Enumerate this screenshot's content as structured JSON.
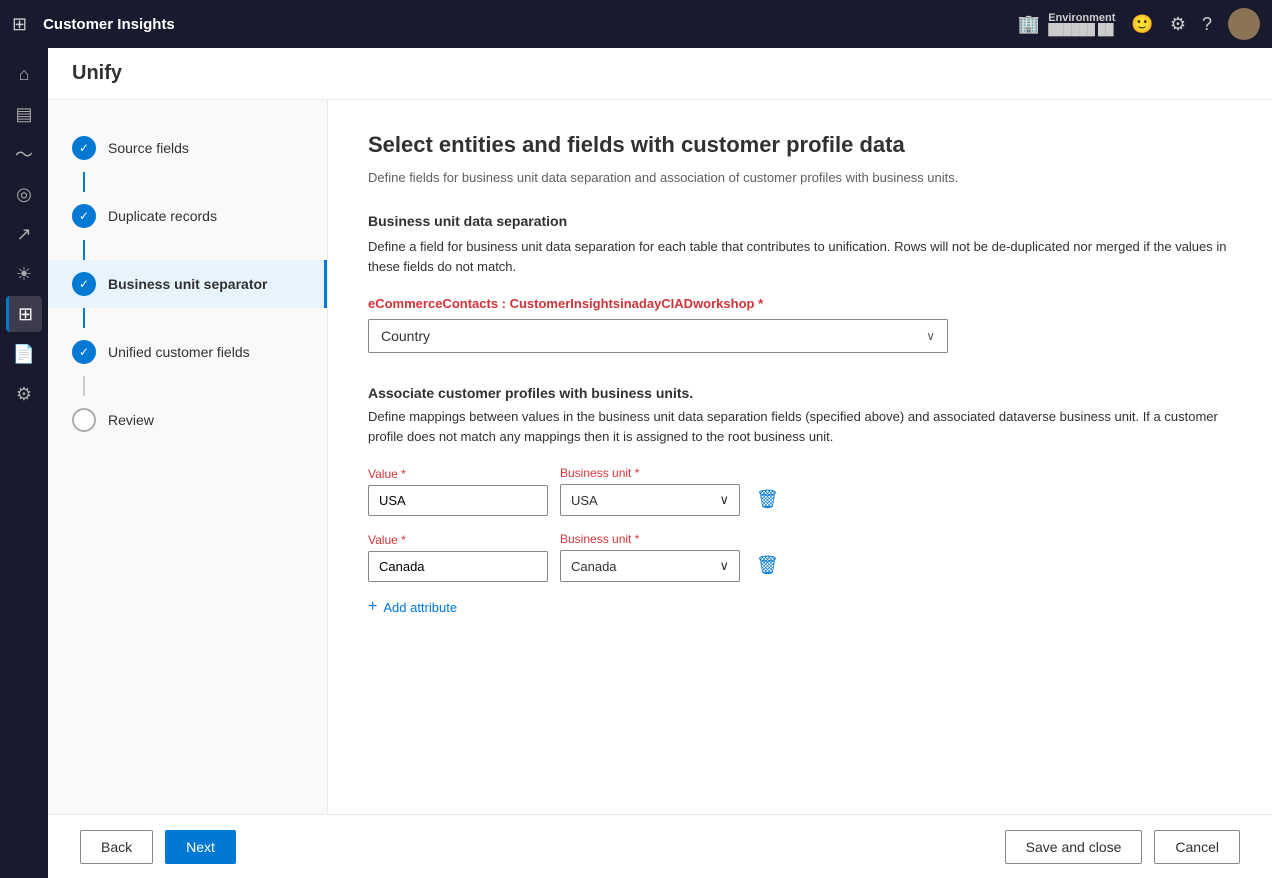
{
  "app": {
    "title": "Customer Insights",
    "page_title": "Unify"
  },
  "environment": {
    "label": "Environment",
    "value": "██████ ██"
  },
  "nav": {
    "icons": [
      "grid",
      "home",
      "analytics",
      "target",
      "chart",
      "lightbulb",
      "data",
      "report",
      "settings"
    ]
  },
  "steps": [
    {
      "id": "source-fields",
      "label": "Source fields",
      "state": "completed"
    },
    {
      "id": "duplicate-records",
      "label": "Duplicate records",
      "state": "completed"
    },
    {
      "id": "business-unit-separator",
      "label": "Business unit separator",
      "state": "active"
    },
    {
      "id": "unified-customer-fields",
      "label": "Unified customer fields",
      "state": "completed"
    },
    {
      "id": "review",
      "label": "Review",
      "state": "empty"
    }
  ],
  "content": {
    "title": "Select entities and fields with customer profile data",
    "subtitle": "Define fields for business unit data separation and association of customer profiles with business units.",
    "business_unit_section": {
      "title": "Business unit data separation",
      "description": "Define a field for business unit data separation for each table that contributes to unification. Rows will not be de-duplicated nor merged if the values in these fields do not match.",
      "entity_label": "eCommerceContacts : CustomerInsightsinadayCIADworkshop",
      "entity_required": "*",
      "dropdown_value": "Country",
      "dropdown_placeholder": "Country"
    },
    "associate_section": {
      "title": "Associate customer profiles with business units.",
      "description": "Define mappings between values in the business unit data separation fields (specified above) and associated dataverse business unit. If a customer profile does not match any mappings then it is assigned to the root business unit.",
      "mappings": [
        {
          "value_label": "Value",
          "value_required": "*",
          "value": "USA",
          "business_unit_label": "Business unit",
          "business_unit_required": "*",
          "business_unit": "USA"
        },
        {
          "value_label": "Value",
          "value_required": "*",
          "value": "Canada",
          "business_unit_label": "Business unit",
          "business_unit_required": "*",
          "business_unit": "Canada"
        }
      ],
      "add_attribute_label": "+ Add attribute"
    }
  },
  "footer": {
    "back_label": "Back",
    "next_label": "Next",
    "save_close_label": "Save and close",
    "cancel_label": "Cancel"
  }
}
